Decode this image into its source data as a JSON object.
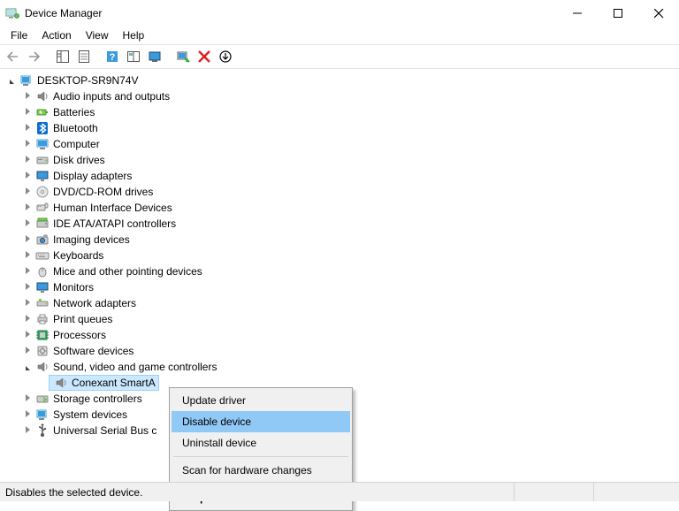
{
  "window": {
    "title": "Device Manager"
  },
  "menu": {
    "items": [
      "File",
      "Action",
      "View",
      "Help"
    ]
  },
  "tree": {
    "root": "DESKTOP-SR9N74V",
    "categories": [
      {
        "label": "Audio inputs and outputs",
        "expanded": false,
        "icon": "speaker"
      },
      {
        "label": "Batteries",
        "expanded": false,
        "icon": "battery"
      },
      {
        "label": "Bluetooth",
        "expanded": false,
        "icon": "bluetooth"
      },
      {
        "label": "Computer",
        "expanded": false,
        "icon": "computer"
      },
      {
        "label": "Disk drives",
        "expanded": false,
        "icon": "disk"
      },
      {
        "label": "Display adapters",
        "expanded": false,
        "icon": "display"
      },
      {
        "label": "DVD/CD-ROM drives",
        "expanded": false,
        "icon": "optical"
      },
      {
        "label": "Human Interface Devices",
        "expanded": false,
        "icon": "hid"
      },
      {
        "label": "IDE ATA/ATAPI controllers",
        "expanded": false,
        "icon": "ide"
      },
      {
        "label": "Imaging devices",
        "expanded": false,
        "icon": "camera"
      },
      {
        "label": "Keyboards",
        "expanded": false,
        "icon": "keyboard"
      },
      {
        "label": "Mice and other pointing devices",
        "expanded": false,
        "icon": "mouse"
      },
      {
        "label": "Monitors",
        "expanded": false,
        "icon": "monitor"
      },
      {
        "label": "Network adapters",
        "expanded": false,
        "icon": "network"
      },
      {
        "label": "Print queues",
        "expanded": false,
        "icon": "printer"
      },
      {
        "label": "Processors",
        "expanded": false,
        "icon": "cpu"
      },
      {
        "label": "Software devices",
        "expanded": false,
        "icon": "software"
      },
      {
        "label": "Sound, video and game controllers",
        "expanded": true,
        "icon": "speaker",
        "children": [
          {
            "label": "Conexant SmartAudio HD",
            "icon": "speaker",
            "selected": true,
            "truncatedLabel": "Conexant SmartA"
          }
        ]
      },
      {
        "label": "Storage controllers",
        "expanded": false,
        "icon": "storage"
      },
      {
        "label": "System devices",
        "expanded": false,
        "icon": "system"
      },
      {
        "label": "Universal Serial Bus controllers",
        "expanded": false,
        "icon": "usb",
        "truncatedLabel": "Universal Serial Bus c"
      }
    ]
  },
  "contextMenu": {
    "items": [
      {
        "label": "Update driver",
        "type": "item"
      },
      {
        "label": "Disable device",
        "type": "item",
        "highlight": true
      },
      {
        "label": "Uninstall device",
        "type": "item"
      },
      {
        "type": "sep"
      },
      {
        "label": "Scan for hardware changes",
        "type": "item"
      },
      {
        "type": "sep"
      },
      {
        "label": "Properties",
        "type": "item",
        "bold": true
      }
    ]
  },
  "status": {
    "text": "Disables the selected device."
  }
}
